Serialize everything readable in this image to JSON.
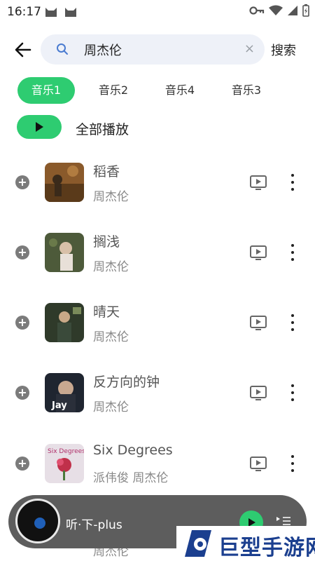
{
  "status_bar": {
    "time": "16:17"
  },
  "search": {
    "query": "周杰伦",
    "button_label": "搜索"
  },
  "tabs": [
    {
      "label": "音乐1",
      "active": true
    },
    {
      "label": "音乐2",
      "active": false
    },
    {
      "label": "音乐4",
      "active": false
    },
    {
      "label": "音乐3",
      "active": false
    }
  ],
  "play_all_label": "全部播放",
  "songs": [
    {
      "title": "稻香",
      "artist": "周杰伦",
      "cover_color": "#8a5a2b"
    },
    {
      "title": "搁浅",
      "artist": "周杰伦",
      "cover_color": "#4d5a3a"
    },
    {
      "title": "晴天",
      "artist": "周杰伦",
      "cover_color": "#2f3a2a"
    },
    {
      "title": "反方向的钟",
      "artist": "周杰伦",
      "cover_color": "#1f2530",
      "cover_text": "Jay"
    },
    {
      "title": "Six Degrees",
      "artist": "派伟俊 周杰伦",
      "cover_color": "#e7dfe6",
      "cover_text": "Six Degrees"
    }
  ],
  "player": {
    "title": "听·下-plus",
    "peek_artist": "周杰伦"
  },
  "watermark": {
    "text": "巨型手游网"
  },
  "colors": {
    "accent": "#2ecc71",
    "player_bg": "#5d5d5d",
    "search_bg": "#eef1f8",
    "brand_blue": "#1b3f8f"
  },
  "icons": [
    "back-arrow-icon",
    "search-icon",
    "clear-icon",
    "play-icon",
    "add-circle-icon",
    "mv-icon",
    "more-vertical-icon",
    "playlist-icon"
  ]
}
